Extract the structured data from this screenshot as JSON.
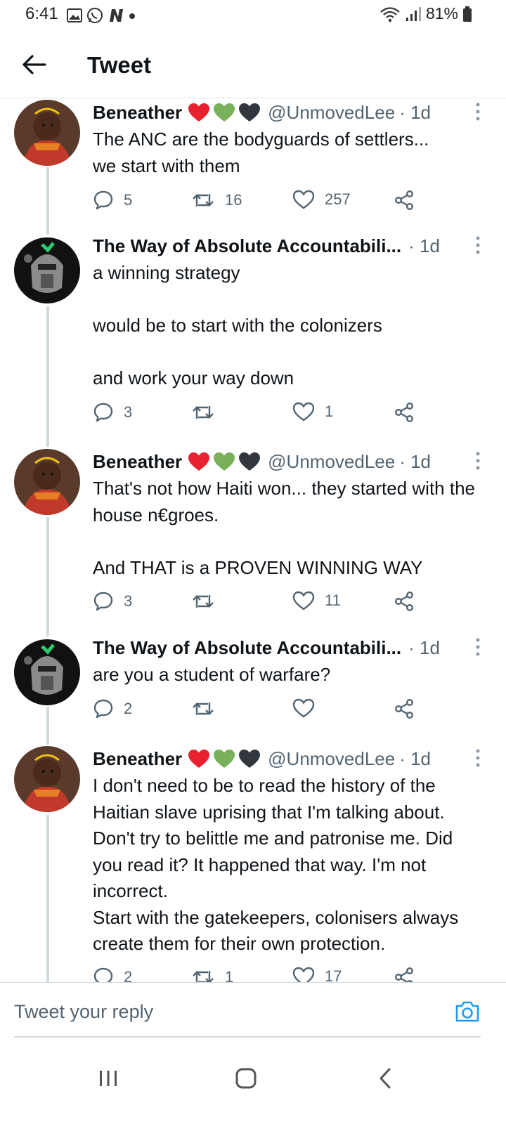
{
  "status": {
    "time": "6:41",
    "battery": "81%",
    "left_icons": [
      "gallery-icon",
      "whatsapp-icon",
      "n-app-icon",
      "dot-icon"
    ],
    "right_icons": [
      "wifi-icon",
      "signal-icon",
      "battery-icon"
    ]
  },
  "header": {
    "title": "Tweet"
  },
  "tweets": [
    {
      "name": "Beneather",
      "emojis": [
        "red-heart",
        "green-heart",
        "black-heart"
      ],
      "handle": "@UnmovedLee",
      "meta": "· 1d",
      "text": "The ANC are the bodyguards of settlers...\nwe start with them",
      "replies": "5",
      "retweets": "16",
      "likes": "257"
    },
    {
      "name": "The Way of Absolute Accountabili...",
      "handle": "",
      "meta": "· 1d",
      "text": "a winning strategy\n\nwould be to start with the colonizers\n\nand work your way down",
      "replies": "3",
      "retweets": "",
      "likes": "1"
    },
    {
      "name": "Beneather",
      "emojis": [
        "red-heart",
        "green-heart",
        "black-heart"
      ],
      "handle": "@UnmovedLee",
      "meta": "· 1d",
      "text": "That's not how Haiti won... they started with the house n€groes.\n\nAnd THAT is a PROVEN WINNING WAY",
      "replies": "3",
      "retweets": "",
      "likes": "11"
    },
    {
      "name": "The Way of Absolute Accountabili...",
      "handle": "",
      "meta": "· 1d",
      "text": "are you a student of warfare?",
      "replies": "2",
      "retweets": "",
      "likes": ""
    },
    {
      "name": "Beneather",
      "emojis": [
        "red-heart",
        "green-heart",
        "black-heart"
      ],
      "handle": "@UnmovedLee",
      "meta": "· 1d",
      "text": "I don't need to be to read the history of the Haitian slave uprising that I'm talking about. Don't try to belittle me and patronise me. Did you read it? It happened that way. I'm not incorrect.\nStart with the gatekeepers, colonisers always create them for their own protection.",
      "replies": "2",
      "retweets": "1",
      "likes": "17"
    }
  ],
  "reply": {
    "placeholder": "Tweet your reply"
  },
  "colors": {
    "accent": "#1d9bf0",
    "text": "#0f1419",
    "muted": "#536471",
    "thread_line": "#cfd9de",
    "heart_red": "#e8202f",
    "heart_green": "#78b159",
    "heart_black": "#31373d"
  },
  "nav": {
    "icons": [
      "recent-apps-icon",
      "home-icon",
      "back-nav-icon"
    ]
  }
}
